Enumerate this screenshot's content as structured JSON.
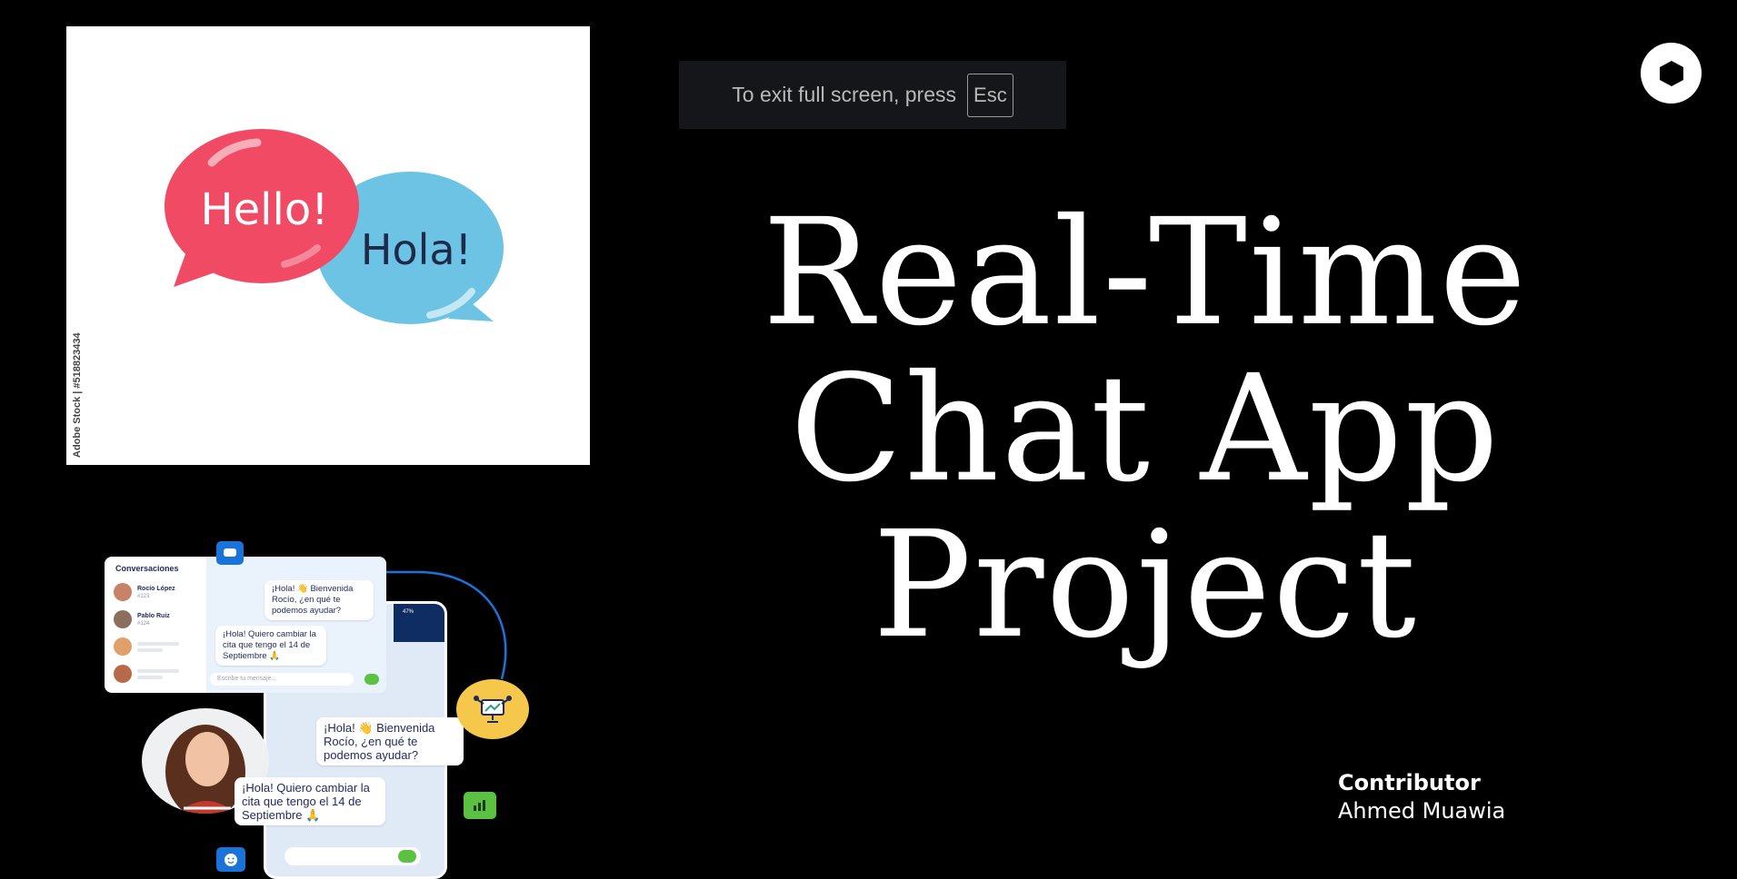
{
  "fullscreen_banner": {
    "text": "To exit full screen, press",
    "key": "Esc"
  },
  "hero_image": {
    "bubble_left": "Hello!",
    "bubble_right": "Hola!",
    "stock_credit": "Adobe Stock | #518823434"
  },
  "title": {
    "line1": "Real-Time",
    "line2": "Chat App",
    "line3": "Project"
  },
  "contributor": {
    "label": "Contributor",
    "name": "Ahmed Muawia"
  },
  "chat_illustration": {
    "panel_title": "Conversaciones",
    "contacts": [
      {
        "name": "Rocío López",
        "id": "#123"
      },
      {
        "name": "Pablo Ruiz",
        "id": "#124"
      }
    ],
    "message_in": "¡Hola! 👋 Bienvenida Rocío, ¿en qué te podemos ayudar?",
    "message_out": "¡Hola! Quiero cambiar la cita que tengo el 14 de Septiembre 🙏",
    "input_placeholder": "Escribe tu mensaje...",
    "phone_status": "47%"
  },
  "colors": {
    "background": "#000000",
    "bubble_red": "#f04a64",
    "bubble_blue": "#6cc3e3",
    "brand_blue": "#1a73d9",
    "accent_green": "#5cc142",
    "robot_yellow": "#f5c84b"
  },
  "icons": [
    "brand-logo-icon",
    "chat-bubble-icon",
    "analytics-icon",
    "robot-monitor-icon",
    "smile-icon",
    "send-icon",
    "mic-icon"
  ]
}
